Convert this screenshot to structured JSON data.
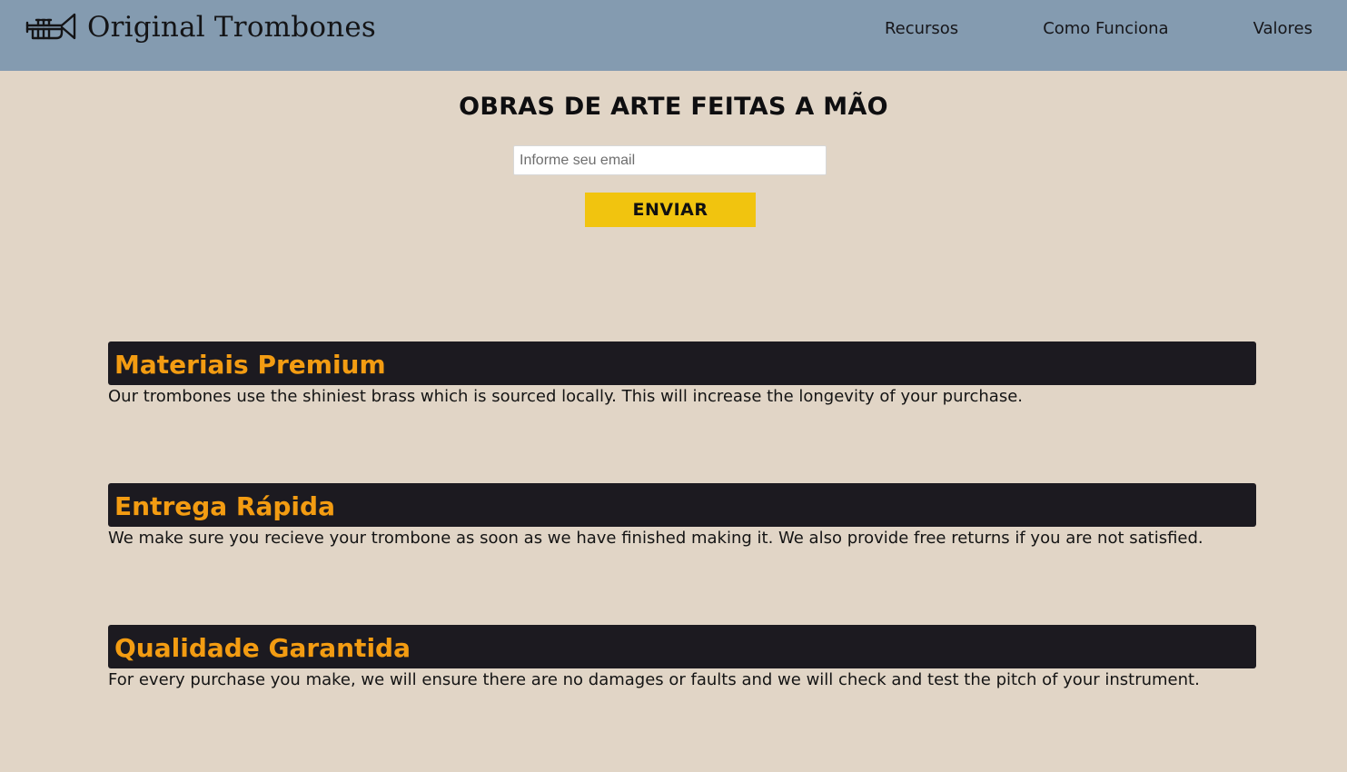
{
  "header": {
    "logo_text": "Original Trombones",
    "logo_icon": "trumpet-icon",
    "nav": [
      {
        "label": "Recursos"
      },
      {
        "label": "Como Funciona"
      },
      {
        "label": "Valores"
      }
    ]
  },
  "hero": {
    "title": "OBRAS DE ARTE FEITAS A MÃO",
    "email_placeholder": "Informe seu email",
    "email_value": "",
    "submit_label": "ENVIAR"
  },
  "features": [
    {
      "title": "Materiais Premium",
      "description": "Our trombones use the shiniest brass which is sourced locally. This will increase the longevity of your purchase."
    },
    {
      "title": "Entrega Rápida",
      "description": "We make sure you recieve your trombone as soon as we have finished making it. We also provide free returns if you are not satisfied."
    },
    {
      "title": "Qualidade Garantida",
      "description": "For every purchase you make, we will ensure there are no damages or faults and we will check and test the pitch of your instrument."
    }
  ],
  "colors": {
    "page_background": "#e1d5c6",
    "header_background": "#849bb0",
    "button_background": "#f1c40f",
    "feature_header_background": "#1c1a20",
    "feature_title_color": "#f39c12"
  }
}
